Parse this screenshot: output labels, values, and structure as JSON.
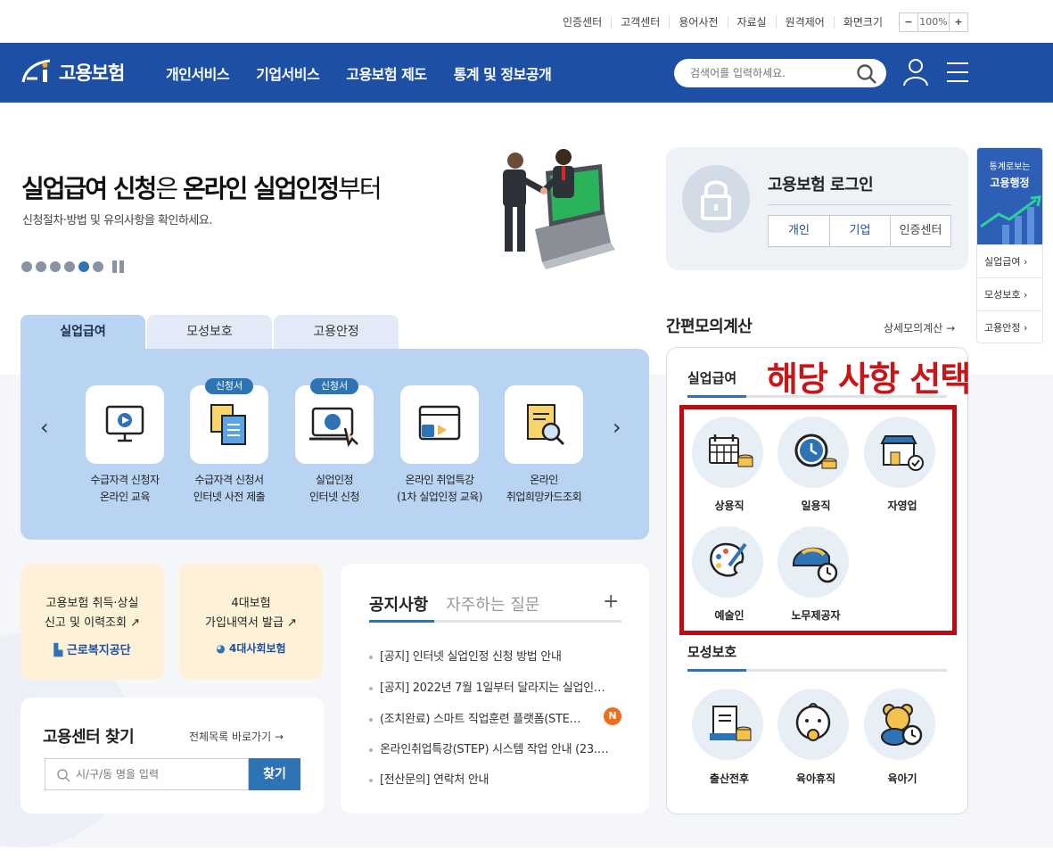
{
  "util": {
    "links": [
      "인증센터",
      "고객센터",
      "용어사전",
      "자료실",
      "원격제어",
      "화면크기"
    ],
    "zoom_minus": "−",
    "zoom_value": "100%",
    "zoom_plus": "+"
  },
  "header": {
    "logo": "고용보험",
    "menu": [
      "개인서비스",
      "기업서비스",
      "고용보험 제도",
      "통계 및 정보공개"
    ],
    "search_placeholder": "검색어를 입력하세요."
  },
  "hero": {
    "title_a": "실업급여 신청",
    "title_b": "은 ",
    "title_c": "온라인 실업인정",
    "title_d": "부터",
    "subtitle": "신청절차·방법 및 유의사항을 확인하세요."
  },
  "login": {
    "title": "고용보험 로그인",
    "buttons": [
      "개인",
      "기업",
      "인증센터"
    ]
  },
  "side": {
    "top_line1": "통계로보는",
    "top_line2": "고용행정",
    "items": [
      "실업급여",
      "모성보호",
      "고용안정"
    ]
  },
  "tabs": [
    "실업급여",
    "모성보호",
    "고용안정"
  ],
  "services": [
    {
      "line1": "수급자격 신청자",
      "line2": "온라인 교육",
      "badge": ""
    },
    {
      "line1": "수급자격 신청서",
      "line2": "인터넷 사전 제출",
      "badge": "신청서"
    },
    {
      "line1": "실업인정",
      "line2": "인터넷 신청",
      "badge": "신청서"
    },
    {
      "line1": "온라인 취업특강",
      "line2": "(1차 실업인정 교육)",
      "badge": ""
    },
    {
      "line1": "온라인",
      "line2": "취업희망카드조회",
      "badge": ""
    }
  ],
  "cards": {
    "c1_line1": "고용보험 취득·상실",
    "c1_line2": "신고 및 이력조회",
    "c1_org": "근로복지공단",
    "c2_line1": "4대보험",
    "c2_line2": "가입내역서 발급",
    "c2_org": "4대사회보험"
  },
  "notice": {
    "tab_active": "공지사항",
    "tab_other": "자주하는 질문",
    "plus": "+",
    "badge": "N",
    "items": [
      "[공지] 인터넷 실업인정 신청 방법 안내",
      "[공지] 2022년 7월 1일부터 달라지는 실업인…",
      "(조치완료) 스마트 직업훈련 플랫폼(STE…",
      "온라인취업특강(STEP) 시스템 작업 안내 (23.…",
      "[전산문의] 연락처 안내"
    ]
  },
  "center": {
    "title": "고용센터 찾기",
    "more": "전체목록 바로가기",
    "placeholder": "시/구/동 명을 입력",
    "button": "찾기"
  },
  "calc": {
    "title": "간편모의계산",
    "more": "상세모의계산",
    "annotation": "해당 사항 선택",
    "section1": "실업급여",
    "items1": [
      "상용직",
      "일용직",
      "자영업",
      "예술인",
      "노무제공자"
    ],
    "section2": "모성보호",
    "items2": [
      "출산전후",
      "육아휴직",
      "육아기"
    ]
  },
  "colors": {
    "brand": "#1d4fa4",
    "accent": "#2e74b5",
    "annotation": "#c81517"
  }
}
